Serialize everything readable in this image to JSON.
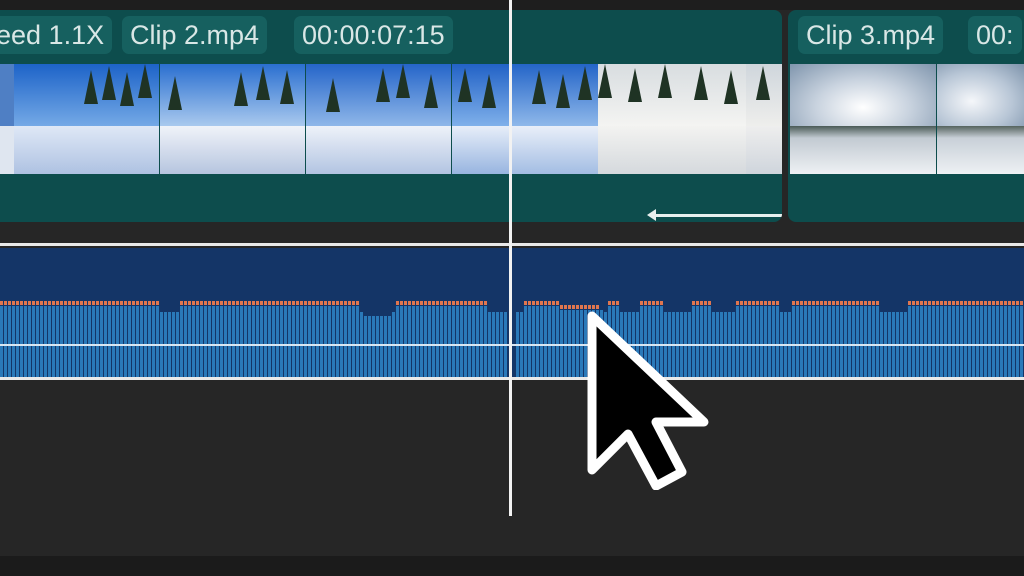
{
  "clips": [
    {
      "id": "clip-2",
      "labels": [
        "eed 1.1X",
        "Clip 2.mp4",
        "00:00:07:15"
      ],
      "speed_label": "eed 1.1X",
      "name": "Clip 2.mp4",
      "duration": "00:00:07:15"
    },
    {
      "id": "clip-3",
      "labels": [
        "Clip 3.mp4",
        "00:"
      ],
      "name": "Clip 3.mp4",
      "duration_partial": "00:"
    }
  ],
  "colors": {
    "clip_bg": "#0d4d4d",
    "chip_bg": "#16605f",
    "audio_bg": "#143567",
    "waveform": "#2a79b9",
    "peak": "#e0764f",
    "playhead": "#f2f2f2",
    "timeline_bg": "#262626"
  },
  "icons": {
    "cursor": "mouse-pointer-icon",
    "speed_arrow": "arrow-left-icon"
  }
}
